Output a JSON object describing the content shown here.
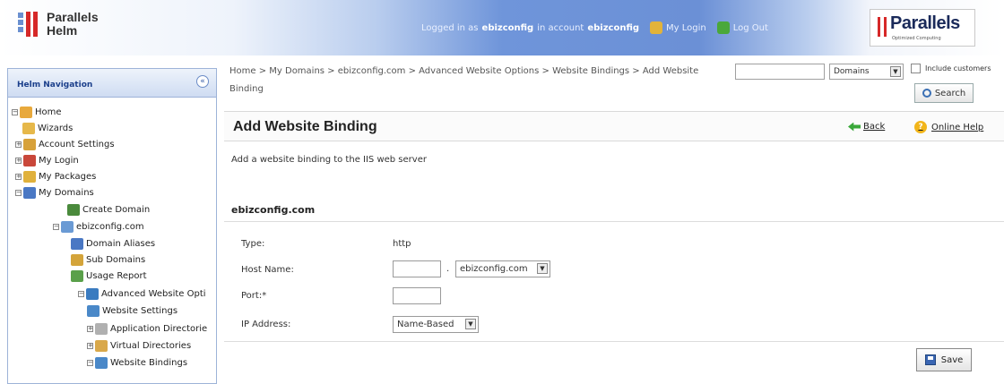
{
  "header": {
    "logo_line1": "Parallels",
    "logo_line2": "Helm",
    "logged_in_prefix": "Logged in as",
    "user": "ebizconfig",
    "in_account": "in account",
    "account": "ebizconfig",
    "my_login": "My Login",
    "log_out": "Log Out",
    "brand": "Parallels",
    "brand_sub": "Optimized Computing"
  },
  "nav": {
    "title": "Helm Navigation",
    "collapse_glyph": "«",
    "items": [
      {
        "label": "Home",
        "icon": "home-icon",
        "color": "#e8a93c",
        "expander": "−"
      },
      {
        "label": "Wizards",
        "icon": "wand-icon",
        "color": "#e6b84a",
        "expander": ""
      },
      {
        "label": "Account Settings",
        "icon": "folder-icon",
        "color": "#d7a13a",
        "expander": "+"
      },
      {
        "label": "My Login",
        "icon": "user-icon",
        "color": "#c9473a",
        "expander": "+"
      },
      {
        "label": "My Packages",
        "icon": "package-icon",
        "color": "#e0b13c",
        "expander": "+"
      },
      {
        "label": "My Domains",
        "icon": "domains-icon",
        "color": "#4a78c4",
        "expander": "−"
      },
      {
        "label": "Create Domain",
        "icon": "create-domain-icon",
        "color": "#4a8a3c",
        "expander": ""
      },
      {
        "label": "ebizconfig.com",
        "icon": "domain-icon",
        "color": "#6a9ad4",
        "expander": "−"
      },
      {
        "label": "Domain Aliases",
        "icon": "alias-icon",
        "color": "#4a78c4",
        "expander": ""
      },
      {
        "label": "Sub Domains",
        "icon": "subdomain-icon",
        "color": "#d4a43a",
        "expander": ""
      },
      {
        "label": "Usage Report",
        "icon": "report-icon",
        "color": "#5aa04a",
        "expander": ""
      },
      {
        "label": "Advanced Website Opti",
        "icon": "globe-icon",
        "color": "#3a7bc0",
        "expander": "−"
      },
      {
        "label": "Website Settings",
        "icon": "settings-icon",
        "color": "#4a88c8",
        "expander": ""
      },
      {
        "label": "Application Directorie",
        "icon": "app-dir-icon",
        "color": "#b0b0b0",
        "expander": "+"
      },
      {
        "label": "Virtual Directories",
        "icon": "virtual-dir-icon",
        "color": "#d9a84a",
        "expander": "+"
      },
      {
        "label": "Website Bindings",
        "icon": "bindings-icon",
        "color": "#4a88c8",
        "expander": "−"
      }
    ]
  },
  "breadcrumb": "Home > My Domains > ebizconfig.com > Advanced Website Options > Website Bindings > Add Website Binding",
  "search": {
    "placeholder": "",
    "scope": "Domains",
    "include_label": "Include customers",
    "button": "Search"
  },
  "page": {
    "title": "Add Website Binding",
    "back": "Back",
    "help": "Online Help",
    "description": "Add a website binding to the IIS web server"
  },
  "form": {
    "section": "ebizconfig.com",
    "type_label": "Type:",
    "type_value": "http",
    "host_label": "Host Name:",
    "host_value": "",
    "host_sep": ".",
    "domain_value": "ebizconfig.com",
    "port_label": "Port:*",
    "port_value": "",
    "ip_label": "IP Address:",
    "ip_value": "Name-Based",
    "save": "Save"
  }
}
